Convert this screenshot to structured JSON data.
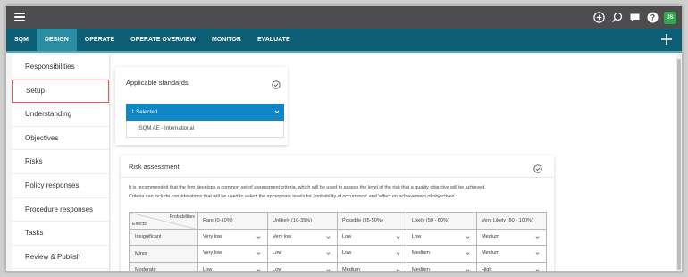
{
  "topbar": {
    "icons": [
      "plus-circle-icon",
      "search-icon",
      "chat-icon",
      "help-icon"
    ],
    "avatar_initials": "JS",
    "avatar_color": "#2fa84f"
  },
  "nav": {
    "tabs": [
      {
        "label": "SQM",
        "active": false
      },
      {
        "label": "DESIGN",
        "active": true
      },
      {
        "label": "OPERATE",
        "active": false
      },
      {
        "label": "OPERATE OVERVIEW",
        "active": false
      },
      {
        "label": "MONITOR",
        "active": false
      },
      {
        "label": "EVALUATE",
        "active": false
      }
    ],
    "colors": {
      "bar": "#0b5e73",
      "active": "#2a8ea3"
    }
  },
  "sidebar": {
    "items": [
      {
        "label": "Responsibilities",
        "selected": false
      },
      {
        "label": "Setup",
        "selected": true
      },
      {
        "label": "Understanding",
        "selected": false
      },
      {
        "label": "Objectives",
        "selected": false
      },
      {
        "label": "Risks",
        "selected": false
      },
      {
        "label": "Policy responses",
        "selected": false
      },
      {
        "label": "Procedure responses",
        "selected": false
      },
      {
        "label": "Tasks",
        "selected": false
      },
      {
        "label": "Review & Publish",
        "selected": false
      }
    ],
    "highlight_color": "#e25f58"
  },
  "standards": {
    "title": "Applicable standards",
    "selected_label": "1 Selected",
    "option": "ISQM AE - International",
    "select_color": "#0f86c6"
  },
  "risk": {
    "title": "Risk assessment",
    "description_line1": "It is recommended that the firm develops a common set of assessment criteria, which will be used to assess the level of the risk that a quality objective will be achieved.",
    "description_line2": "Criteria can include considerations that will be used to select the appropriate levels for 'probability of occurrence' and 'effect on achievement of objectives'.",
    "corner_top": "Probabilities",
    "corner_bottom": "Effects",
    "columns": [
      "Rare (0-10%)",
      "Unlikely (10-35%)",
      "Possible (35-50%)",
      "Likely (50 - 80%)",
      "Very Likely (80 - 100%)"
    ],
    "rows": [
      {
        "effect": "Insignificant",
        "values": [
          "Very low",
          "Very low",
          "Low",
          "Low",
          "Medium"
        ]
      },
      {
        "effect": "Minor",
        "values": [
          "Very low",
          "Low",
          "Low",
          "Medium",
          "Medium"
        ]
      },
      {
        "effect": "Moderate",
        "values": [
          "Low",
          "Low",
          "Medium",
          "Medium",
          "High"
        ]
      }
    ]
  }
}
